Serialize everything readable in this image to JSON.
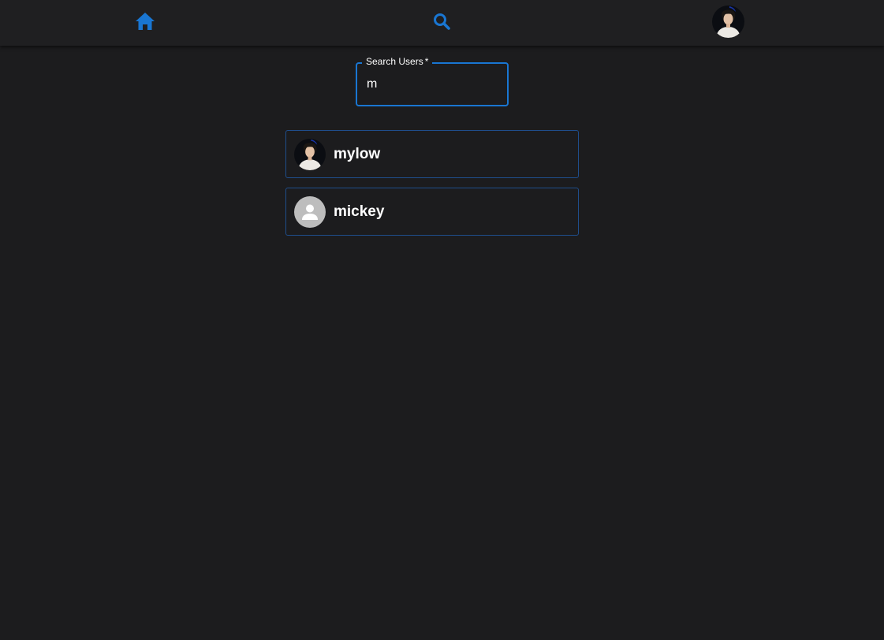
{
  "colors": {
    "accent": "#1976d2",
    "background": "#1c1c1e",
    "topbar": "#1f1f21",
    "item_border": "#1f4e8c"
  },
  "nav": {
    "home_icon": "home-icon",
    "search_icon": "search-icon",
    "profile_avatar": "profile-avatar"
  },
  "search": {
    "label": "Search Users",
    "required_marker": "*",
    "value": "m"
  },
  "results": [
    {
      "username": "mylow",
      "avatar": "photo"
    },
    {
      "username": "mickey",
      "avatar": "default-person-icon"
    }
  ]
}
